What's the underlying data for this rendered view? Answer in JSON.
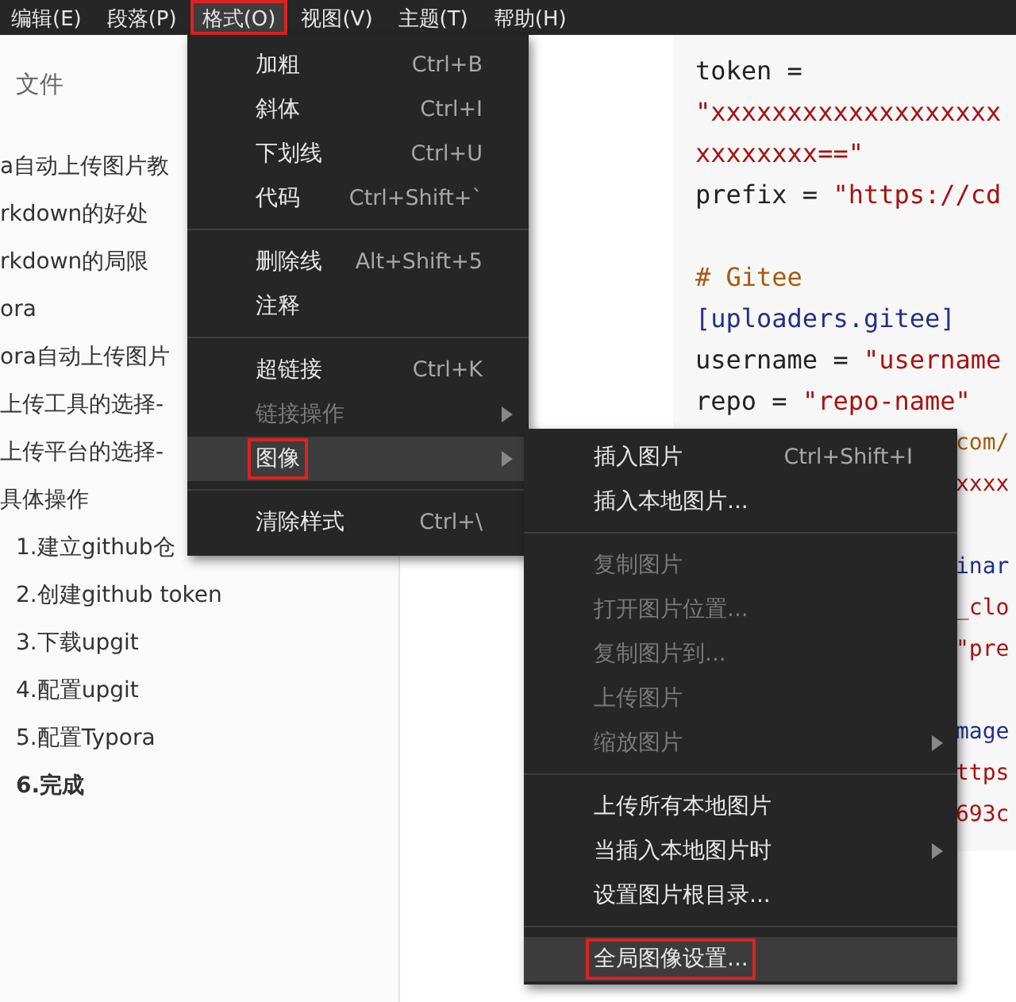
{
  "menubar": {
    "items": [
      {
        "label": "编辑(E)",
        "selected": false,
        "marked": false
      },
      {
        "label": "段落(P)",
        "selected": false,
        "marked": false
      },
      {
        "label": "格式(O)",
        "selected": true,
        "marked": true
      },
      {
        "label": "视图(V)",
        "selected": false,
        "marked": false
      },
      {
        "label": "主题(T)",
        "selected": false,
        "marked": false
      },
      {
        "label": "帮助(H)",
        "selected": false,
        "marked": false
      }
    ]
  },
  "sidebar": {
    "title": "文件",
    "outline": [
      {
        "label": "a自动上传图片教",
        "selected": false
      },
      {
        "label": "rkdown的好处",
        "selected": false
      },
      {
        "label": "rkdown的局限",
        "selected": false
      },
      {
        "label": "ora",
        "selected": false
      },
      {
        "label": "ora自动上传图片",
        "selected": false
      },
      {
        "label": "上传工具的选择-",
        "selected": false
      },
      {
        "label": "上传平台的选择-",
        "selected": false
      },
      {
        "label": "具体操作",
        "selected": false,
        "children": [
          {
            "label": "1.建立github仓",
            "selected": false
          },
          {
            "label": "2.创建github token",
            "selected": false
          },
          {
            "label": "3.下载upgit",
            "selected": false
          },
          {
            "label": "4.配置upgit",
            "selected": false
          },
          {
            "label": "5.配置Typora",
            "selected": false
          },
          {
            "label": "6.完成",
            "selected": true
          }
        ]
      }
    ]
  },
  "editor": {
    "code_lines": [
      {
        "kind": "full",
        "segments": [
          {
            "kind": "plain",
            "text": "token ="
          }
        ]
      },
      {
        "kind": "full",
        "segments": [
          {
            "kind": "string",
            "text": "\"xxxxxxxxxxxxxxxxxxx"
          }
        ]
      },
      {
        "kind": "full",
        "segments": [
          {
            "kind": "string",
            "text": "xxxxxxxx==\""
          }
        ]
      },
      {
        "kind": "full",
        "segments": [
          {
            "kind": "plain",
            "text": "prefix = "
          },
          {
            "kind": "string",
            "text": "\"https://cd"
          }
        ]
      },
      {
        "kind": "blank"
      },
      {
        "kind": "full",
        "segments": [
          {
            "kind": "comment",
            "text": "# Gitee"
          }
        ]
      },
      {
        "kind": "full",
        "segments": [
          {
            "kind": "section",
            "text": "[uploaders.gitee]"
          }
        ]
      },
      {
        "kind": "full",
        "segments": [
          {
            "kind": "plain",
            "text": "username = "
          },
          {
            "kind": "string",
            "text": "\"username"
          }
        ]
      },
      {
        "kind": "full",
        "segments": [
          {
            "kind": "plain",
            "text": "repo = "
          },
          {
            "kind": "string",
            "text": "\"repo-name\""
          }
        ]
      },
      {
        "kind": "partial",
        "segments": [
          {
            "kind": "comment",
            "text": "com/"
          }
        ]
      },
      {
        "kind": "partial",
        "segments": [
          {
            "kind": "string",
            "text": "xxxx"
          }
        ]
      },
      {
        "kind": "blank"
      },
      {
        "kind": "partial",
        "segments": [
          {
            "kind": "section",
            "text": "inar"
          }
        ]
      },
      {
        "kind": "partial",
        "segments": [
          {
            "kind": "string",
            "text": "_clo"
          }
        ]
      },
      {
        "kind": "partial",
        "segments": [
          {
            "kind": "string",
            "text": "\"pre"
          }
        ]
      },
      {
        "kind": "blank"
      },
      {
        "kind": "partial",
        "segments": [
          {
            "kind": "section",
            "text": "mage"
          }
        ]
      },
      {
        "kind": "partial",
        "segments": [
          {
            "kind": "string",
            "text": "ttps"
          }
        ]
      },
      {
        "kind": "partial",
        "segments": [
          {
            "kind": "string",
            "text": "693c"
          }
        ]
      }
    ]
  },
  "format_menu": {
    "items": [
      {
        "kind": "item",
        "label": "加粗",
        "shortcut": "Ctrl+B",
        "disabled": false,
        "submenu": false,
        "selected": false,
        "marked": false
      },
      {
        "kind": "item",
        "label": "斜体",
        "shortcut": "Ctrl+I",
        "disabled": false,
        "submenu": false,
        "selected": false,
        "marked": false
      },
      {
        "kind": "item",
        "label": "下划线",
        "shortcut": "Ctrl+U",
        "disabled": false,
        "submenu": false,
        "selected": false,
        "marked": false
      },
      {
        "kind": "item",
        "label": "代码",
        "shortcut": "Ctrl+Shift+`",
        "disabled": false,
        "submenu": false,
        "selected": false,
        "marked": false
      },
      {
        "kind": "separator"
      },
      {
        "kind": "item",
        "label": "删除线",
        "shortcut": "Alt+Shift+5",
        "disabled": false,
        "submenu": false,
        "selected": false,
        "marked": false
      },
      {
        "kind": "item",
        "label": "注释",
        "disabled": false,
        "submenu": false,
        "selected": false,
        "marked": false
      },
      {
        "kind": "separator"
      },
      {
        "kind": "item",
        "label": "超链接",
        "shortcut": "Ctrl+K",
        "disabled": false,
        "submenu": false,
        "selected": false,
        "marked": false
      },
      {
        "kind": "item",
        "label": "链接操作",
        "disabled": true,
        "submenu": true,
        "selected": false,
        "marked": false
      },
      {
        "kind": "item",
        "label": "图像",
        "disabled": false,
        "submenu": true,
        "selected": true,
        "marked": true
      },
      {
        "kind": "separator"
      },
      {
        "kind": "item",
        "label": "清除样式",
        "shortcut": "Ctrl+\\",
        "disabled": false,
        "submenu": false,
        "selected": false,
        "marked": false
      }
    ]
  },
  "image_submenu": {
    "items": [
      {
        "kind": "item",
        "label": "插入图片",
        "shortcut": "Ctrl+Shift+I",
        "disabled": false,
        "submenu": false,
        "selected": false,
        "marked": false
      },
      {
        "kind": "item",
        "label": "插入本地图片...",
        "disabled": false,
        "submenu": false,
        "selected": false,
        "marked": false
      },
      {
        "kind": "separator"
      },
      {
        "kind": "item",
        "label": "复制图片",
        "disabled": true,
        "submenu": false,
        "selected": false,
        "marked": false
      },
      {
        "kind": "item",
        "label": "打开图片位置...",
        "disabled": true,
        "submenu": false,
        "selected": false,
        "marked": false
      },
      {
        "kind": "item",
        "label": "复制图片到...",
        "disabled": true,
        "submenu": false,
        "selected": false,
        "marked": false
      },
      {
        "kind": "item",
        "label": "上传图片",
        "disabled": true,
        "submenu": false,
        "selected": false,
        "marked": false
      },
      {
        "kind": "item",
        "label": "缩放图片",
        "disabled": true,
        "submenu": true,
        "selected": false,
        "marked": false
      },
      {
        "kind": "separator"
      },
      {
        "kind": "item",
        "label": "上传所有本地图片",
        "disabled": false,
        "submenu": false,
        "selected": false,
        "marked": false
      },
      {
        "kind": "item",
        "label": "当插入本地图片时",
        "disabled": false,
        "submenu": true,
        "selected": false,
        "marked": false
      },
      {
        "kind": "item",
        "label": "设置图片根目录...",
        "disabled": false,
        "submenu": false,
        "selected": false,
        "marked": false
      },
      {
        "kind": "separator"
      },
      {
        "kind": "item",
        "label": "全局图像设置...",
        "disabled": false,
        "submenu": false,
        "selected": true,
        "marked": true
      }
    ]
  }
}
